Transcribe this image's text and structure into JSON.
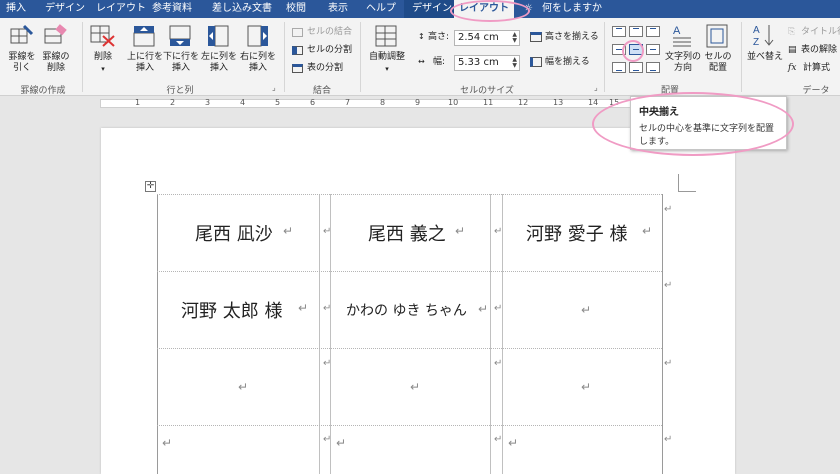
{
  "tabs": [
    "挿入",
    "デザイン",
    "レイアウト",
    "参考資料",
    "差し込み文書",
    "校閲",
    "表示",
    "ヘルプ",
    "デザイン",
    "レイアウト"
  ],
  "tell_me": "何をしますか",
  "ribbon": {
    "draw": {
      "group": "罫線の作成",
      "draw_border": "罫線を\n引く",
      "eraser": "罫線の\n削除"
    },
    "rows_cols": {
      "group": "行と列",
      "delete": "削除",
      "insert_above": "上に行を\n挿入",
      "insert_below": "下に行を\n挿入",
      "insert_left": "左に列を\n挿入",
      "insert_right": "右に列を\n挿入"
    },
    "merge": {
      "group": "結合",
      "merge_cells": "セルの結合",
      "split_cells": "セルの分割",
      "split_table": "表の分割"
    },
    "cell_size": {
      "group": "セルのサイズ",
      "autofit": "自動調整",
      "height_label": "高さ:",
      "height_value": "2.54 cm",
      "width_label": "幅:",
      "width_value": "5.33 cm",
      "distribute_rows": "高さを揃える",
      "distribute_cols": "幅を揃える"
    },
    "alignment": {
      "group": "配置",
      "text_direction": "文字列の\n方向",
      "cell_margins": "セルの\n配置"
    },
    "data": {
      "group": "データ",
      "sort": "並べ替え",
      "repeat_header": "タイトル行",
      "convert": "表の解除",
      "formula": "計算式"
    }
  },
  "ruler_numbers": [
    "1",
    "2",
    "3",
    "4",
    "5",
    "6",
    "7",
    "8",
    "9",
    "10",
    "11",
    "12",
    "13",
    "14",
    "15"
  ],
  "tooltip": {
    "title": "中央揃え",
    "desc": "セルの中心を基準に文字列を配置します。"
  },
  "cells": [
    [
      "尾西 凪沙",
      "尾西 義之",
      "河野 愛子 様"
    ],
    [
      "河野 太郎 様",
      "かわの ゆき ちゃん",
      ""
    ],
    [
      "",
      "",
      ""
    ],
    [
      "",
      "",
      ""
    ]
  ],
  "marks": {
    "return": "↵",
    "cell_end": "↵",
    "row_end": "↵"
  },
  "colors": {
    "accent": "#2b579a",
    "annotation": "#f09bc4"
  }
}
